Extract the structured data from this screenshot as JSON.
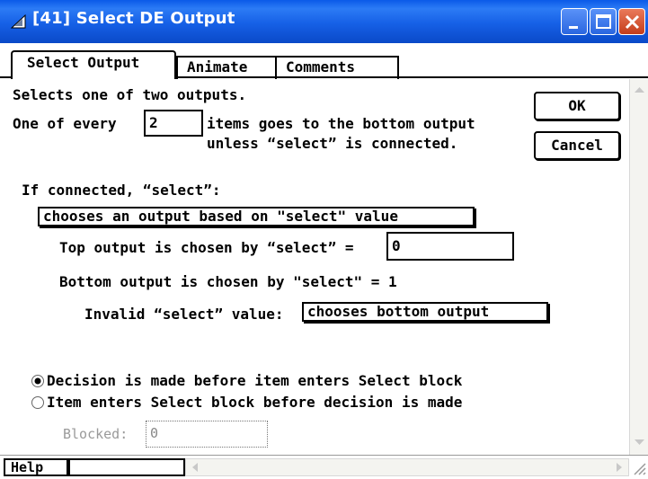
{
  "window": {
    "title": "[41]  Select DE Output"
  },
  "tabs": [
    {
      "label": "Select Output"
    },
    {
      "label": "Animate"
    },
    {
      "label": "Comments"
    }
  ],
  "content": {
    "description": "Selects one of two outputs.",
    "one_of_every_label": "One of every",
    "one_of_every_value": "2",
    "items_line1": "items goes to the bottom output",
    "items_line2": "unless “select” is connected.",
    "if_connected_label": "If connected, “select”:",
    "select_mode_value": "chooses an output based on \"select\" value",
    "top_output_label": "Top output is chosen by “select” =",
    "top_output_value": "0",
    "bottom_output_text": "Bottom output is chosen by \"select\" =  1",
    "invalid_label": "Invalid “select” value:",
    "invalid_value": "chooses bottom output",
    "radio_options": [
      {
        "label": "Decision is made before item enters Select block",
        "selected": true
      },
      {
        "label": "Item enters Select block before decision is made",
        "selected": false
      }
    ],
    "blocked_label": "Blocked:",
    "blocked_value": "0"
  },
  "buttons": {
    "ok": "OK",
    "cancel": "Cancel",
    "help": "Help"
  },
  "colors": {
    "titlebar": "#0a5ae8",
    "close_button": "#c43d1b"
  }
}
